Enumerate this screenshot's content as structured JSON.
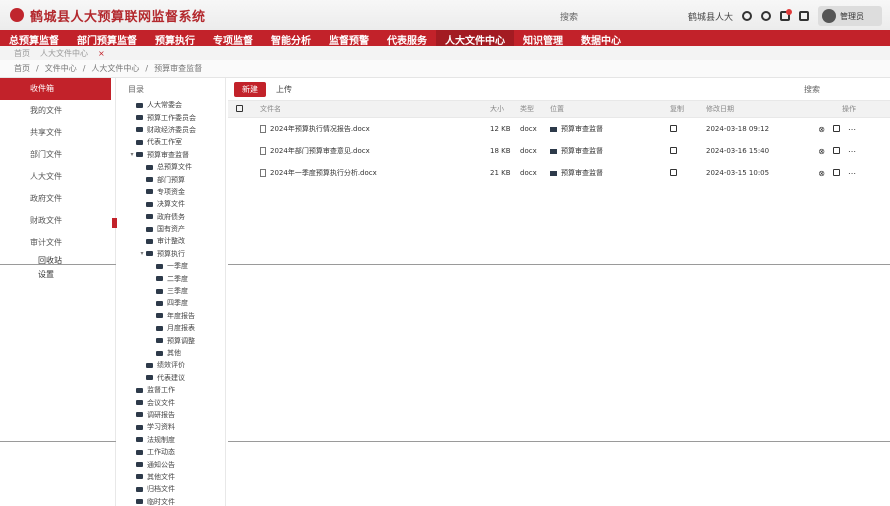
{
  "app": {
    "title": "鹤城县人大预算联网监督系统",
    "search_hint": "搜索",
    "user_label": "鹤城县人大",
    "avatar_name": "管理员"
  },
  "nav": [
    {
      "label": "总预算监督"
    },
    {
      "label": "部门预算监督"
    },
    {
      "label": "预算执行"
    },
    {
      "label": "专项监督"
    },
    {
      "label": "智能分析"
    },
    {
      "label": "监督预警"
    },
    {
      "label": "代表服务"
    },
    {
      "label": "人大文件中心",
      "active": true
    },
    {
      "label": "知识管理"
    },
    {
      "label": "数据中心"
    }
  ],
  "tabs": [
    "首页",
    "人大文件中心"
  ],
  "breadcrumb": [
    "首页",
    "文件中心",
    "人大文件中心",
    "预算审查监督"
  ],
  "side_items": [
    {
      "label": "收件箱",
      "active": true
    },
    {
      "label": "我的文件",
      "active": false
    },
    {
      "label": "共享文件",
      "active": false
    },
    {
      "label": "部门文件",
      "active": false
    },
    {
      "label": "人大文件",
      "active": false
    },
    {
      "label": "政府文件",
      "active": false
    },
    {
      "label": "财政文件",
      "active": false
    },
    {
      "label": "审计文件",
      "active": false
    }
  ],
  "side_subitems": [
    "回收站",
    "设置"
  ],
  "tree": {
    "header": "目录",
    "nodes": [
      {
        "indent": 0,
        "label": "人大常委会"
      },
      {
        "indent": 0,
        "label": "预算工作委员会"
      },
      {
        "indent": 0,
        "label": "财政经济委员会"
      },
      {
        "indent": 0,
        "label": "代表工作室"
      },
      {
        "indent": 0,
        "label": "预算审查监督",
        "expanded": true
      },
      {
        "indent": 1,
        "label": "总预算文件"
      },
      {
        "indent": 1,
        "label": "部门预算"
      },
      {
        "indent": 1,
        "label": "专项资金"
      },
      {
        "indent": 1,
        "label": "决算文件"
      },
      {
        "indent": 1,
        "label": "政府债务"
      },
      {
        "indent": 1,
        "label": "国有资产"
      },
      {
        "indent": 1,
        "label": "审计整改"
      },
      {
        "indent": 1,
        "label": "预算执行",
        "expanded": true
      },
      {
        "indent": 2,
        "label": "一季度"
      },
      {
        "indent": 2,
        "label": "二季度"
      },
      {
        "indent": 2,
        "label": "三季度"
      },
      {
        "indent": 2,
        "label": "四季度"
      },
      {
        "indent": 2,
        "label": "年度报告"
      },
      {
        "indent": 2,
        "label": "月度报表"
      },
      {
        "indent": 2,
        "label": "预算调整"
      },
      {
        "indent": 2,
        "label": "其他"
      },
      {
        "indent": 1,
        "label": "绩效评价"
      },
      {
        "indent": 1,
        "label": "代表建议"
      },
      {
        "indent": 0,
        "label": "监督工作"
      },
      {
        "indent": 0,
        "label": "会议文件"
      },
      {
        "indent": 0,
        "label": "调研报告"
      },
      {
        "indent": 0,
        "label": "学习资料"
      },
      {
        "indent": 0,
        "label": "法规制度"
      },
      {
        "indent": 0,
        "label": "工作动态"
      },
      {
        "indent": 0,
        "label": "通知公告"
      },
      {
        "indent": 0,
        "label": "其他文件"
      },
      {
        "indent": 0,
        "label": "归档文件"
      },
      {
        "indent": 0,
        "label": "临时文件"
      }
    ]
  },
  "toolbar": {
    "new_label": "新建",
    "upload_label": "上传",
    "search_label": "搜索"
  },
  "table": {
    "headers": [
      "文件名",
      "大小",
      "类型",
      "位置",
      "复制",
      "修改日期",
      "操作"
    ],
    "rows": [
      {
        "name": "2024年预算执行情况报告.docx",
        "size": "12 KB",
        "type": "docx",
        "location": "预算审查监督",
        "date": "2024-03-18 09:12"
      },
      {
        "name": "2024年部门预算审查意见.docx",
        "size": "18 KB",
        "type": "docx",
        "location": "预算审查监督",
        "date": "2024-03-16 15:40"
      },
      {
        "name": "2024年一季度预算执行分析.docx",
        "size": "21 KB",
        "type": "docx",
        "location": "预算审查监督",
        "date": "2024-03-15 10:05"
      }
    ]
  }
}
